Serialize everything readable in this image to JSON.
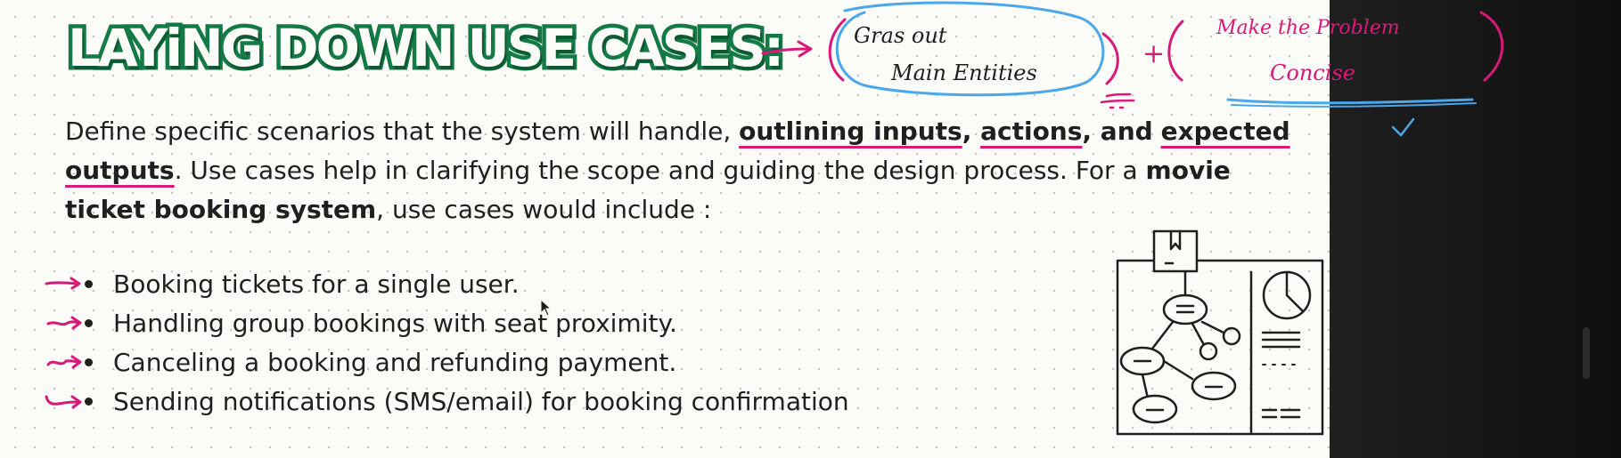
{
  "slide": {
    "title": "LAYiNG DOWN USE CASES:",
    "paragraph": {
      "part1": "Define specific scenarios that the system will handle, ",
      "inputs_phrase": "outlining inputs",
      "sep1": ", ",
      "actions_word": "actions",
      "sep2": ", ",
      "and_word": "and",
      "sep3": " ",
      "outputs_phrase": "expected outputs",
      "part2": ". Use cases help in clarifying the scope and guiding the design process. For a ",
      "system_phrase": "movie ticket booking system",
      "part3": ", use cases would include :"
    },
    "use_cases": [
      "Booking tickets for a single user.",
      "Handling group bookings with seat proximity.",
      "Canceling a booking and refunding payment.",
      "Sending notifications (SMS/email) for booking confirmation"
    ]
  },
  "annotations": {
    "note_1_line_1": "Gras out",
    "note_1_line_2": "Main Entities",
    "plus": "+",
    "note_2_line_1": "Make the Problem",
    "note_2_line_2": "Concise",
    "check": "✓"
  },
  "colors": {
    "title_green": "#137a45",
    "annotation_pink": "#d8197a",
    "annotation_blue": "#4aa7ea",
    "slide_bg": "#fbfbf7"
  },
  "icons": {
    "illustration": "document-flowchart-icon",
    "bullet_arrows": "hand-drawn-arrow-icon",
    "cursor": "mouse-cursor-icon"
  }
}
